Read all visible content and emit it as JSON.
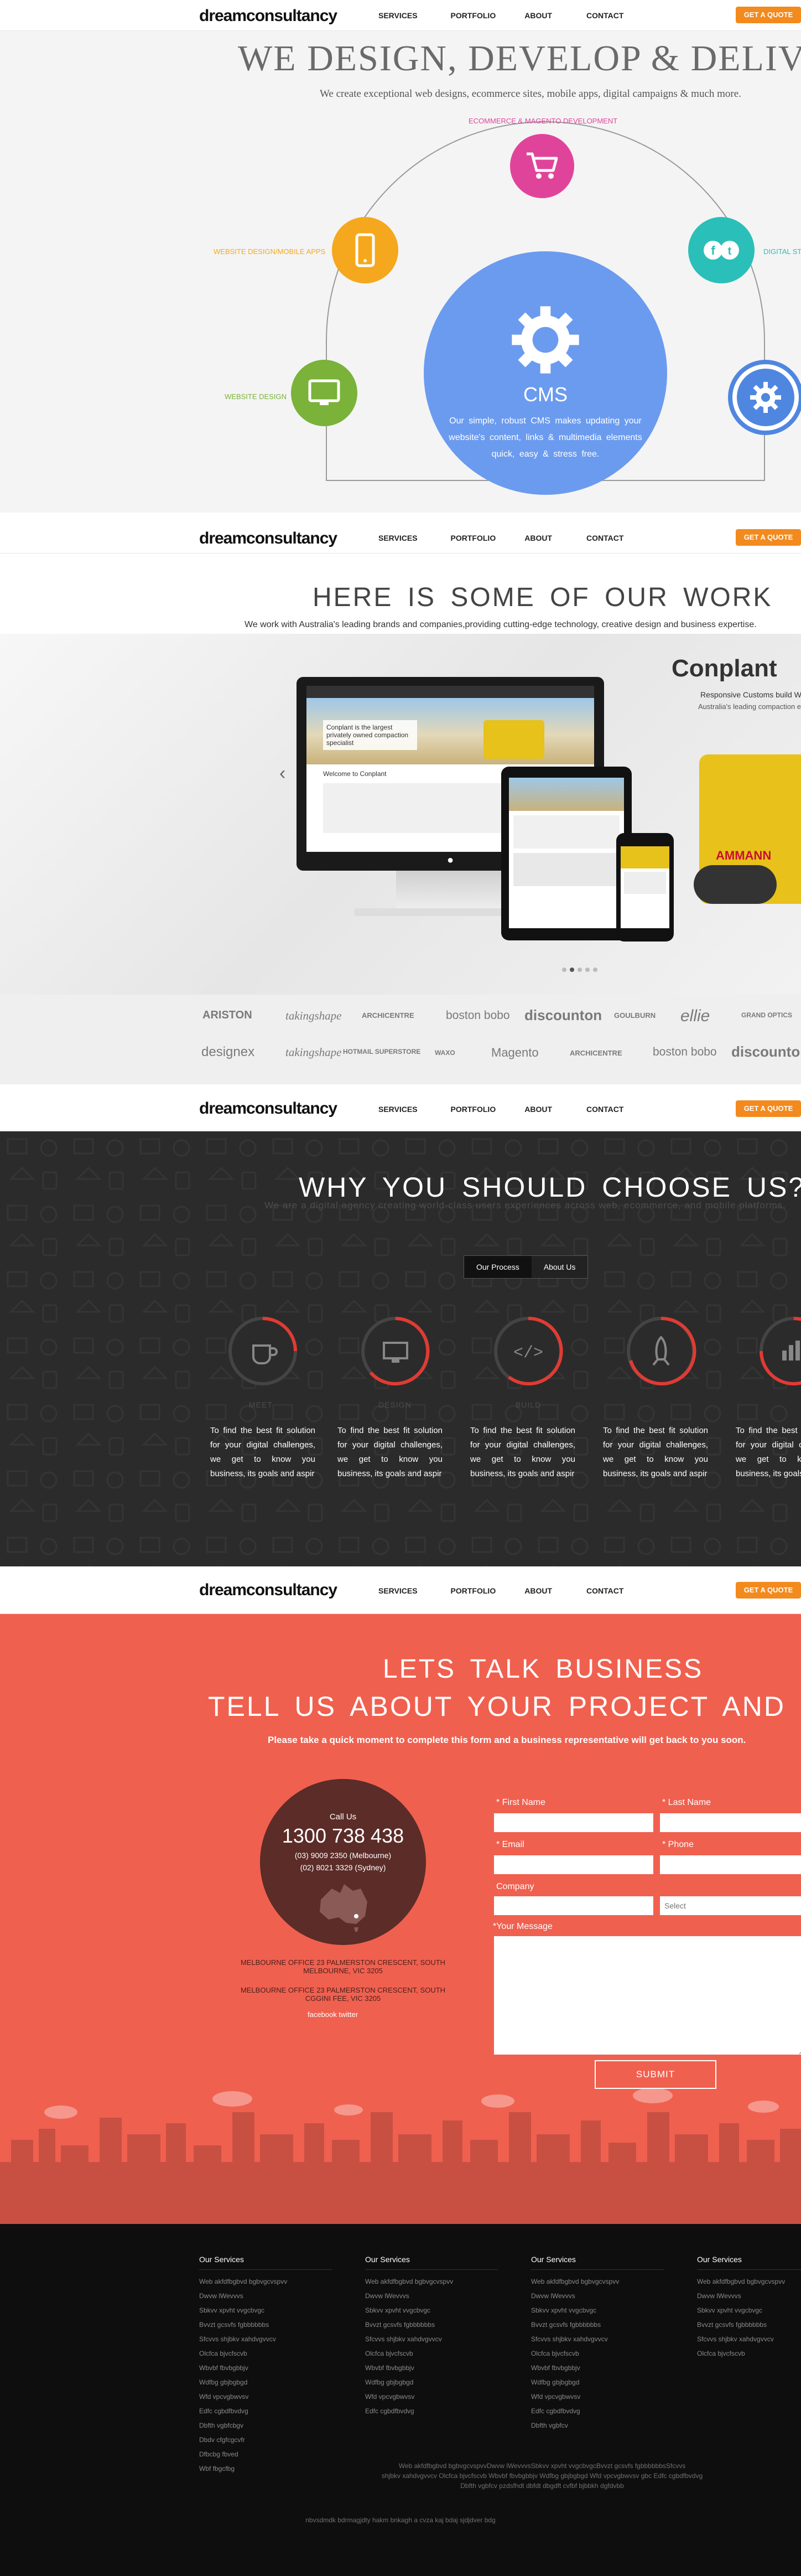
{
  "header": {
    "logo": "dreamconsultancy",
    "nav": [
      "SERVICES",
      "PORTFOLIO",
      "ABOUT",
      "CONTACT"
    ],
    "quote": "GET A QUOTE"
  },
  "hero": {
    "title": "WE DESIGN, DEVELOP & DELIVER",
    "subtitle": "We create exceptional web designs, ecommerce sites, mobile apps, digital campaigns & much more.",
    "services": {
      "ecommerce": "ECOMMERCE & MAGENTO DEVELOPMENT",
      "mobile": "WEBSITE DESIGN/MOBILE APPS",
      "digital": "DIGITAL STRATEGY",
      "website": "WEBSITE DESIGN"
    },
    "cms_title": "CMS",
    "cms_text": "Our simple, robust CMS makes updating your website's content, links & multimedia elements quick, easy & stress free."
  },
  "portfolio": {
    "title": "HERE IS SOME OF OUR WORK",
    "subtitle": "We work with Australia's leading brands and companies,providing cutting-edge technology, creative design and business expertise.",
    "slide_brand": "Conplant",
    "slide_tagline": "Responsive Customs build Website",
    "slide_tagline2": "Australia's leading compaction equipment",
    "slide_site_heading": "Conplant is the largest privately owned compaction specialist",
    "slide_welcome": "Welcome to Conplant",
    "slide_roller": "AMMANN",
    "clients_row1": [
      "ARISTON",
      "takingshape",
      "ARCHICENTRE",
      "boston bobo",
      "discounton",
      "GOULBURN",
      "ellie",
      "GRAND OPTICS"
    ],
    "clients_row2": [
      "designex",
      "takingshape",
      "HOTMAIL SUPERSTORE",
      "WAXO",
      "Magento",
      "ARCHICENTRE",
      "boston bobo",
      "discounton"
    ]
  },
  "why": {
    "title": "WHY YOU SHOULD CHOOSE US?",
    "subtitle": "We are a digital agency creating world-class users experiences across web, ecommerce, and mobile platforms.",
    "tabs": [
      "Our Process",
      "About Us"
    ],
    "steps": [
      {
        "name": "MEET",
        "icon": "coffee-icon",
        "desc": "To find the best fit solution for your digital challenges, we get to know you business, its goals and aspir"
      },
      {
        "name": "DESIGN",
        "icon": "monitor-icon",
        "desc": "To find the best fit solution for your digital challenges, we get to know you business, its goals and aspir"
      },
      {
        "name": "BUILD",
        "icon": "code-icon",
        "desc": "To find the best fit solution for your digital challenges, we get to know you business, its goals and aspir"
      },
      {
        "name": "LAUNCH",
        "icon": "rocket-icon",
        "desc": "To find the best fit solution for your digital challenges, we get to know you business, its goals and aspir"
      },
      {
        "name": "GROW",
        "icon": "chart-icon",
        "desc": "To find the best fit solution for your digital challenges, we get to know you business, its goals and aspir"
      }
    ]
  },
  "contact": {
    "title1": "LETS TALK BUSINESS",
    "title2": "TELL US ABOUT YOUR PROJECT AND BUDGET",
    "subtitle": "Please take a quick moment to complete this form and a business representative will get back to you soon.",
    "call_us": "Call Us",
    "phone": "1300 738 438",
    "phone_melb": "(03) 9009 2350 (Melbourne)",
    "phone_syd": "(02) 8021 3329 (Sydney)",
    "office1": "MELBOURNE OFFICE 23 PALMERSTON CRESCENT, SOUTH MELBOURNE, VIC 3205",
    "office2": "MELBOURNE OFFICE 23 PALMERSTON CRESCENT, SOUTH CGGINI FEE, VIC 3205",
    "social": "facebook twitter",
    "first_name": "* First Name",
    "last_name": "* Last Name",
    "email": "* Email",
    "phone_label": "* Phone",
    "company": "Company",
    "budget_placeholder": "Select",
    "message": "*Your Message",
    "submit": "SUBMIT"
  },
  "footer": {
    "columns": [
      {
        "head": "Our Services",
        "items": [
          "Web akfdfbgbvd bgbvgcvspvv",
          "Dwvw lWevvvs",
          "Sbkvv xpvht vvgcbvgc",
          "Bvvzt gcsvfs fgbbbbbbs",
          "Sfcvvs shjbkv xahdvgvvcv",
          "Olcfca bjvcfscvb",
          "Wbvbf fbvbgbbjv",
          "Wdfbg gbjbgbgd",
          "Wfd vpcvgbwvsv",
          "Edfc cgbdfbvdvg",
          "Dbfth vgbfcbgv",
          "Dbdv cfgfcgcvfr",
          "Dfbcbg fbved",
          "Wbf fbgcfbg"
        ]
      },
      {
        "head": "Our Services",
        "items": [
          "Web akfdfbgbvd bgbvgcvspvv",
          "Dwvw lWevvvs",
          "Sbkvv xpvht vvgcbvgc",
          "Bvvzt gcsvfs fgbbbbbbs",
          "Sfcvvs shjbkv xahdvgvvcv",
          "Olcfca bjvcfscvb",
          "Wbvbf fbvbgbbjv",
          "Wdfbg gbjbgbgd",
          "Wfd vpcvgbwvsv",
          "Edfc cgbdfbvdvg"
        ]
      },
      {
        "head": "Our Services",
        "items": [
          "Web akfdfbgbvd bgbvgcvspvv",
          "Dwvw lWevvvs",
          "Sbkvv xpvht vvgcbvgc",
          "Bvvzt gcsvfs fgbbbbbbs",
          "Sfcvvs shjbkv xahdvgvvcv",
          "Olcfca bjvcfscvb",
          "Wbvbf fbvbgbbjv",
          "Wdfbg gbjbgbgd",
          "Wfd vpcvgbwvsv",
          "Edfc cgbdfbvdvg",
          "Dbfth vgbfcv"
        ]
      },
      {
        "head": "Our Services",
        "items": [
          "Web akfdfbgbvd bgbvgcvspvv",
          "Dwvw lWevvvs",
          "Sbkvv xpvht vvgcbvgc",
          "Bvvzt gcsvfs fgbbbbbbs",
          "Sfcvvs shjbkv xahdvgvvcv",
          "Olcfca bjvcfscvb"
        ]
      }
    ],
    "small_line1": "Web akfdfbgbvd bgbvgcvspvvDwvw lWevvvsSbkvv xpvht vvgcbvgcBvvzt gcsvfs fgbbbbbbsSfcvvs",
    "small_line2": "shjbkv xahdvgvvcv Olcfca bjvcfscvb Wbvbf fbvbgbbjv Wdfbg gbjbgbgd Wfd vpcvgbwvsv gbc Edfc cgbdfbvdvg",
    "small_line3": "Dbfth vgbfcv pzdsfhdt dbfdt dbgdft cvfbf bjbbkh dgfdvbb",
    "bottom": "nbvsdmdk bdrmagjdty hakm bnkagh a cvza kaj bdaj sjdjdver bdg"
  }
}
